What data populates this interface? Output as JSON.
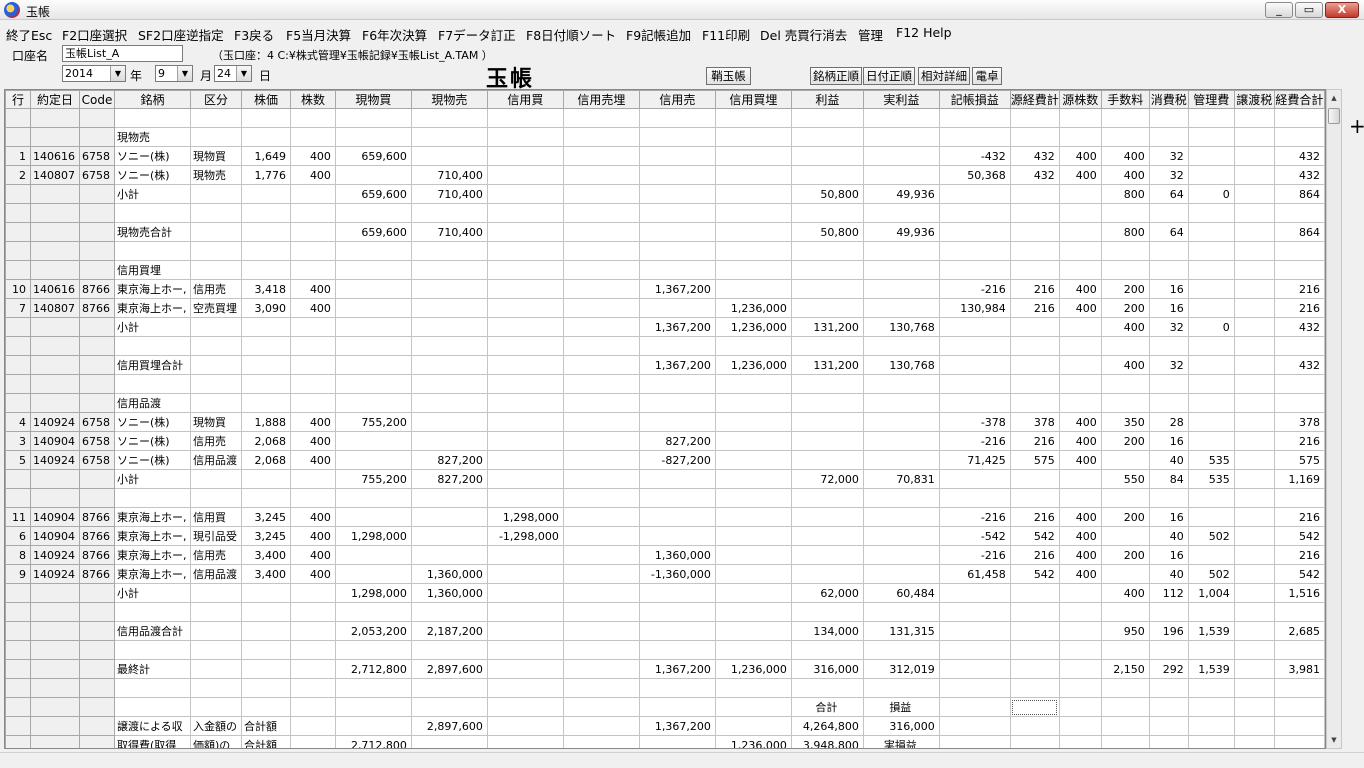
{
  "window": {
    "title": "玉帳",
    "buttons": [
      "_",
      "▭",
      "X"
    ]
  },
  "menu": [
    "終了Esc",
    "F2口座選択",
    "SF2口座逆指定",
    "F3戻る",
    "F5当月決算",
    "F6年次決算",
    "F7データ訂正",
    "F8日付順ソート",
    "F9記帳追加",
    "F11印刷",
    "Del 売買行消去",
    "管理",
    "F12 Help"
  ],
  "account": {
    "label": "口座名",
    "name": "玉帳List_A",
    "path": "（玉口座：4  C:¥株式管理¥玉帳記録¥玉帳List_A.TAM ）"
  },
  "date": {
    "year": "2014",
    "year_label": "年",
    "month": "9",
    "month_label": "月",
    "day": "24",
    "day_label": "日"
  },
  "page_title": "玉帳",
  "buttons": {
    "saya": "鞘玉帳",
    "sort_name": "銘柄正順",
    "sort_date": "日付正順",
    "relative": "相対詳細",
    "calc": "電卓"
  },
  "columns": [
    "行",
    "約定日",
    "Code",
    "銘柄",
    "区分",
    "株価",
    "株数",
    "現物買",
    "現物売",
    "信用買",
    "信用売埋",
    "信用売",
    "信用買埋",
    "利益",
    "実利益",
    "記帳損益",
    "源経費計",
    "源株数",
    "手数料",
    "消費税",
    "管理費",
    "譲渡税",
    "経費合計"
  ],
  "rows": [
    [
      "",
      "",
      "",
      "",
      "",
      "",
      "",
      "",
      "",
      "",
      "",
      "",
      "",
      "",
      "",
      "",
      "",
      "",
      "",
      "",
      "",
      "",
      ""
    ],
    [
      "",
      "",
      "",
      "現物売",
      "",
      "",
      "",
      "",
      "",
      "",
      "",
      "",
      "",
      "",
      "",
      "",
      "",
      "",
      "",
      "",
      "",
      "",
      ""
    ],
    [
      "1",
      "140616",
      "6758",
      "ソニー(株)",
      "現物買",
      "1,649",
      "400",
      "659,600",
      "",
      "",
      "",
      "",
      "",
      "",
      "",
      "-432",
      "432",
      "400",
      "400",
      "32",
      "",
      "",
      "432"
    ],
    [
      "2",
      "140807",
      "6758",
      "ソニー(株)",
      "現物売",
      "1,776",
      "400",
      "",
      "710,400",
      "",
      "",
      "",
      "",
      "",
      "",
      "50,368",
      "432",
      "400",
      "400",
      "32",
      "",
      "",
      "432"
    ],
    [
      "",
      "",
      "",
      "小計",
      "",
      "",
      "",
      "659,600",
      "710,400",
      "",
      "",
      "",
      "",
      "50,800",
      "49,936",
      "",
      "",
      "",
      "800",
      "64",
      "0",
      "",
      "864"
    ],
    [
      "",
      "",
      "",
      "",
      "",
      "",
      "",
      "",
      "",
      "",
      "",
      "",
      "",
      "",
      "",
      "",
      "",
      "",
      "",
      "",
      "",
      "",
      ""
    ],
    [
      "",
      "",
      "",
      "現物売合計",
      "",
      "",
      "",
      "659,600",
      "710,400",
      "",
      "",
      "",
      "",
      "50,800",
      "49,936",
      "",
      "",
      "",
      "800",
      "64",
      "",
      "",
      "864"
    ],
    [
      "",
      "",
      "",
      "",
      "",
      "",
      "",
      "",
      "",
      "",
      "",
      "",
      "",
      "",
      "",
      "",
      "",
      "",
      "",
      "",
      "",
      "",
      ""
    ],
    [
      "",
      "",
      "",
      "信用買埋",
      "",
      "",
      "",
      "",
      "",
      "",
      "",
      "",
      "",
      "",
      "",
      "",
      "",
      "",
      "",
      "",
      "",
      "",
      ""
    ],
    [
      "10",
      "140616",
      "8766",
      "東京海上ホー,",
      "信用売",
      "3,418",
      "400",
      "",
      "",
      "",
      "",
      "1,367,200",
      "",
      "",
      "",
      "-216",
      "216",
      "400",
      "200",
      "16",
      "",
      "",
      "216"
    ],
    [
      "7",
      "140807",
      "8766",
      "東京海上ホー,",
      "空売買埋",
      "3,090",
      "400",
      "",
      "",
      "",
      "",
      "",
      "1,236,000",
      "",
      "",
      "130,984",
      "216",
      "400",
      "200",
      "16",
      "",
      "",
      "216"
    ],
    [
      "",
      "",
      "",
      "小計",
      "",
      "",
      "",
      "",
      "",
      "",
      "",
      "1,367,200",
      "1,236,000",
      "131,200",
      "130,768",
      "",
      "",
      "",
      "400",
      "32",
      "0",
      "",
      "432"
    ],
    [
      "",
      "",
      "",
      "",
      "",
      "",
      "",
      "",
      "",
      "",
      "",
      "",
      "",
      "",
      "",
      "",
      "",
      "",
      "",
      "",
      "",
      "",
      ""
    ],
    [
      "",
      "",
      "",
      "信用買埋合計",
      "",
      "",
      "",
      "",
      "",
      "",
      "",
      "1,367,200",
      "1,236,000",
      "131,200",
      "130,768",
      "",
      "",
      "",
      "400",
      "32",
      "",
      "",
      "432"
    ],
    [
      "",
      "",
      "",
      "",
      "",
      "",
      "",
      "",
      "",
      "",
      "",
      "",
      "",
      "",
      "",
      "",
      "",
      "",
      "",
      "",
      "",
      "",
      ""
    ],
    [
      "",
      "",
      "",
      "信用品渡",
      "",
      "",
      "",
      "",
      "",
      "",
      "",
      "",
      "",
      "",
      "",
      "",
      "",
      "",
      "",
      "",
      "",
      "",
      ""
    ],
    [
      "4",
      "140924",
      "6758",
      "ソニー(株)",
      "現物買",
      "1,888",
      "400",
      "755,200",
      "",
      "",
      "",
      "",
      "",
      "",
      "",
      "-378",
      "378",
      "400",
      "350",
      "28",
      "",
      "",
      "378"
    ],
    [
      "3",
      "140904",
      "6758",
      "ソニー(株)",
      "信用売",
      "2,068",
      "400",
      "",
      "",
      "",
      "",
      "827,200",
      "",
      "",
      "",
      "-216",
      "216",
      "400",
      "200",
      "16",
      "",
      "",
      "216"
    ],
    [
      "5",
      "140924",
      "6758",
      "ソニー(株)",
      "信用品渡",
      "2,068",
      "400",
      "",
      "827,200",
      "",
      "",
      "-827,200",
      "",
      "",
      "",
      "71,425",
      "575",
      "400",
      "",
      "40",
      "535",
      "",
      "575"
    ],
    [
      "",
      "",
      "",
      "小計",
      "",
      "",
      "",
      "755,200",
      "827,200",
      "",
      "",
      "",
      "",
      "72,000",
      "70,831",
      "",
      "",
      "",
      "550",
      "84",
      "535",
      "",
      "1,169"
    ],
    [
      "",
      "",
      "",
      "",
      "",
      "",
      "",
      "",
      "",
      "",
      "",
      "",
      "",
      "",
      "",
      "",
      "",
      "",
      "",
      "",
      "",
      "",
      ""
    ],
    [
      "11",
      "140904",
      "8766",
      "東京海上ホー,",
      "信用買",
      "3,245",
      "400",
      "",
      "",
      "1,298,000",
      "",
      "",
      "",
      "",
      "",
      "-216",
      "216",
      "400",
      "200",
      "16",
      "",
      "",
      "216"
    ],
    [
      "6",
      "140904",
      "8766",
      "東京海上ホー,",
      "現引品受",
      "3,245",
      "400",
      "1,298,000",
      "",
      "-1,298,000",
      "",
      "",
      "",
      "",
      "",
      "-542",
      "542",
      "400",
      "",
      "40",
      "502",
      "",
      "542"
    ],
    [
      "8",
      "140924",
      "8766",
      "東京海上ホー,",
      "信用売",
      "3,400",
      "400",
      "",
      "",
      "",
      "",
      "1,360,000",
      "",
      "",
      "",
      "-216",
      "216",
      "400",
      "200",
      "16",
      "",
      "",
      "216"
    ],
    [
      "9",
      "140924",
      "8766",
      "東京海上ホー,",
      "信用品渡",
      "3,400",
      "400",
      "",
      "1,360,000",
      "",
      "",
      "-1,360,000",
      "",
      "",
      "",
      "61,458",
      "542",
      "400",
      "",
      "40",
      "502",
      "",
      "542"
    ],
    [
      "",
      "",
      "",
      "小計",
      "",
      "",
      "",
      "1,298,000",
      "1,360,000",
      "",
      "",
      "",
      "",
      "62,000",
      "60,484",
      "",
      "",
      "",
      "400",
      "112",
      "1,004",
      "",
      "1,516"
    ],
    [
      "",
      "",
      "",
      "",
      "",
      "",
      "",
      "",
      "",
      "",
      "",
      "",
      "",
      "",
      "",
      "",
      "",
      "",
      "",
      "",
      "",
      "",
      ""
    ],
    [
      "",
      "",
      "",
      "信用品渡合計",
      "",
      "",
      "",
      "2,053,200",
      "2,187,200",
      "",
      "",
      "",
      "",
      "134,000",
      "131,315",
      "",
      "",
      "",
      "950",
      "196",
      "1,539",
      "",
      "2,685"
    ],
    [
      "",
      "",
      "",
      "",
      "",
      "",
      "",
      "",
      "",
      "",
      "",
      "",
      "",
      "",
      "",
      "",
      "",
      "",
      "",
      "",
      "",
      "",
      ""
    ],
    [
      "",
      "",
      "",
      "最終計",
      "",
      "",
      "",
      "2,712,800",
      "2,897,600",
      "",
      "",
      "1,367,200",
      "1,236,000",
      "316,000",
      "312,019",
      "",
      "",
      "",
      "2,150",
      "292",
      "1,539",
      "",
      "3,981"
    ],
    [
      "",
      "",
      "",
      "",
      "",
      "",
      "",
      "",
      "",
      "",
      "",
      "",
      "",
      "",
      "",
      "",
      "",
      "",
      "",
      "",
      "",
      "",
      ""
    ],
    [
      "",
      "",
      "",
      "",
      "",
      "",
      "",
      "",
      "",
      "",
      "",
      "",
      "",
      "合計",
      "損益",
      "",
      "",
      "",
      "",
      "",
      "",
      "",
      ""
    ],
    [
      "",
      "",
      "",
      "譲渡による収",
      "入金額の",
      "合計額",
      "",
      "",
      "2,897,600",
      "",
      "",
      "1,367,200",
      "",
      "4,264,800",
      "316,000",
      "",
      "",
      "",
      "",
      "",
      "",
      "",
      ""
    ],
    [
      "",
      "",
      "",
      "取得費(取得",
      "価額)の",
      "合計額",
      "",
      "2,712,800",
      "",
      "",
      "",
      "",
      "1,236,000",
      "3,948,800",
      "実損益",
      "",
      "",
      "",
      "",
      "",
      "",
      "",
      ""
    ],
    [
      "",
      "",
      "",
      "譲渡の為の委",
      "託手数料",
      "の合計額",
      "",
      "",
      "",
      "",
      "",
      "",
      "",
      "3,981",
      "312,019",
      "",
      "",
      "",
      "",
      "",
      "",
      "",
      ""
    ]
  ]
}
